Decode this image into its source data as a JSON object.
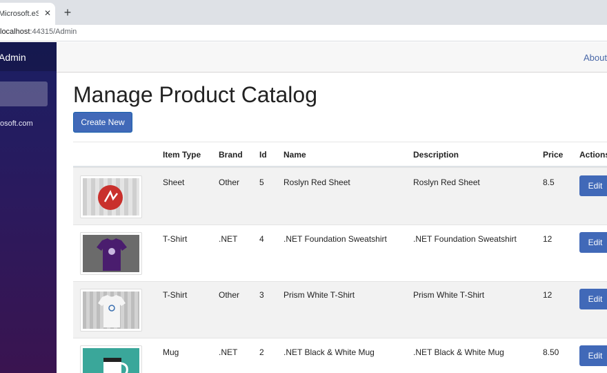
{
  "browser": {
    "tab_title": "Microsoft.eSh",
    "tab_close": "✕",
    "new_tab": "+",
    "url_host": "localhost",
    "url_rest": ":44315/Admin"
  },
  "sidebar": {
    "title": "Admin",
    "email": "osoft.com"
  },
  "topbar": {
    "about_label": "About"
  },
  "main": {
    "title": "Manage Product Catalog",
    "create_label": "Create New"
  },
  "table": {
    "columns": [
      "Item Type",
      "Brand",
      "Id",
      "Name",
      "Description",
      "Price",
      "Actions"
    ],
    "edit_label": "Edit",
    "rows": [
      {
        "item_type": "Sheet",
        "brand": "Other",
        "id": "5",
        "name": "Roslyn Red Sheet",
        "description": "Roslyn Red Sheet",
        "price": "8.5",
        "image": "red-sheet-image"
      },
      {
        "item_type": "T-Shirt",
        "brand": ".NET",
        "id": "4",
        "name": ".NET Foundation Sweatshirt",
        "description": ".NET Foundation Sweatshirt",
        "price": "12",
        "image": "purple-sweatshirt-image"
      },
      {
        "item_type": "T-Shirt",
        "brand": "Other",
        "id": "3",
        "name": "Prism White T-Shirt",
        "description": "Prism White T-Shirt",
        "price": "12",
        "image": "white-tshirt-image"
      },
      {
        "item_type": "Mug",
        "brand": ".NET",
        "id": "2",
        "name": ".NET Black & White Mug",
        "description": ".NET Black & White Mug",
        "price": "8.50",
        "image": "mug-image"
      }
    ]
  },
  "colors": {
    "primary": "#4169b8",
    "sidebar_top": "#1a1f63",
    "sidebar_bottom": "#3a1450",
    "stripe": "#f2f2f2"
  }
}
